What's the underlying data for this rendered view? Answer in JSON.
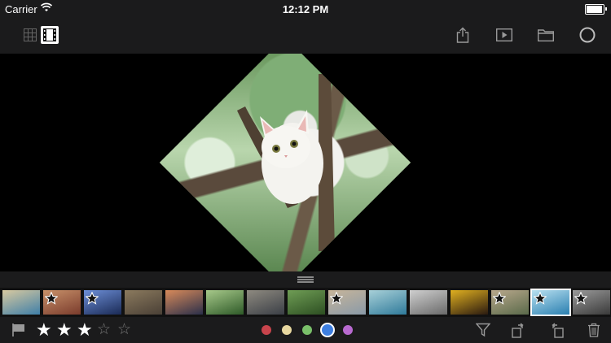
{
  "status_bar": {
    "carrier": "Carrier",
    "time": "12:12 PM",
    "wifi_icon": "wifi-icon",
    "battery_icon": "battery-icon"
  },
  "toolbar": {
    "left_buttons": [
      {
        "icon": "grid-view-icon",
        "selected": false
      },
      {
        "icon": "filmstrip-view-icon",
        "selected": true
      }
    ],
    "right_buttons": [
      {
        "icon": "share-icon"
      },
      {
        "icon": "slideshow-play-icon"
      },
      {
        "icon": "folder-icon"
      },
      {
        "icon": "circle-icon"
      }
    ]
  },
  "viewer": {
    "image_subject": "cat-in-tree-photo",
    "rotation_degrees": 45
  },
  "filmstrip": {
    "thumbnails": [
      {
        "starred": false,
        "colors": [
          "#3f7fa8",
          "#d8c9a0"
        ]
      },
      {
        "starred": true,
        "colors": [
          "#7a3b2c",
          "#c8916a"
        ]
      },
      {
        "starred": true,
        "colors": [
          "#1a2a55",
          "#6d8fd8"
        ]
      },
      {
        "starred": false,
        "colors": [
          "#4a4036",
          "#8b7a5e"
        ]
      },
      {
        "starred": false,
        "colors": [
          "#2a2f4a",
          "#d88a5a"
        ]
      },
      {
        "starred": false,
        "colors": [
          "#2e5a28",
          "#a7c98a"
        ]
      },
      {
        "starred": false,
        "colors": [
          "#3b3f46",
          "#8e8a80"
        ]
      },
      {
        "starred": false,
        "colors": [
          "#2d4f22",
          "#6f9d55"
        ]
      },
      {
        "starred": true,
        "colors": [
          "#8a9aa8",
          "#c7b59a"
        ]
      },
      {
        "starred": false,
        "colors": [
          "#2f7a9a",
          "#a8d0d8"
        ]
      },
      {
        "starred": false,
        "colors": [
          "#6a6a6a",
          "#cfcfcf"
        ]
      },
      {
        "starred": false,
        "colors": [
          "#2a1a10",
          "#e0b020"
        ]
      },
      {
        "starred": true,
        "colors": [
          "#5a6a4a",
          "#b9a88c"
        ]
      },
      {
        "starred": true,
        "colors": [
          "#2a7fb0",
          "#b8e0f0"
        ],
        "selected": true
      },
      {
        "starred": true,
        "colors": [
          "#3a3a3a",
          "#9a9a9a"
        ]
      }
    ]
  },
  "bottom_bar": {
    "flag_icon": "flag-icon",
    "rating": {
      "filled": 3,
      "total": 5,
      "filled_glyph": "★",
      "empty_glyph": "☆"
    },
    "color_labels": [
      {
        "color": "#c8444c",
        "selected": false
      },
      {
        "color": "#e8d8a0",
        "selected": false
      },
      {
        "color": "#7ac06a",
        "selected": false
      },
      {
        "color": "#3e7fe0",
        "selected": true
      },
      {
        "color": "#b86ad0",
        "selected": false
      }
    ],
    "right_icons": [
      "filter-icon",
      "rotate-left-icon",
      "rotate-right-icon",
      "trash-icon"
    ]
  }
}
